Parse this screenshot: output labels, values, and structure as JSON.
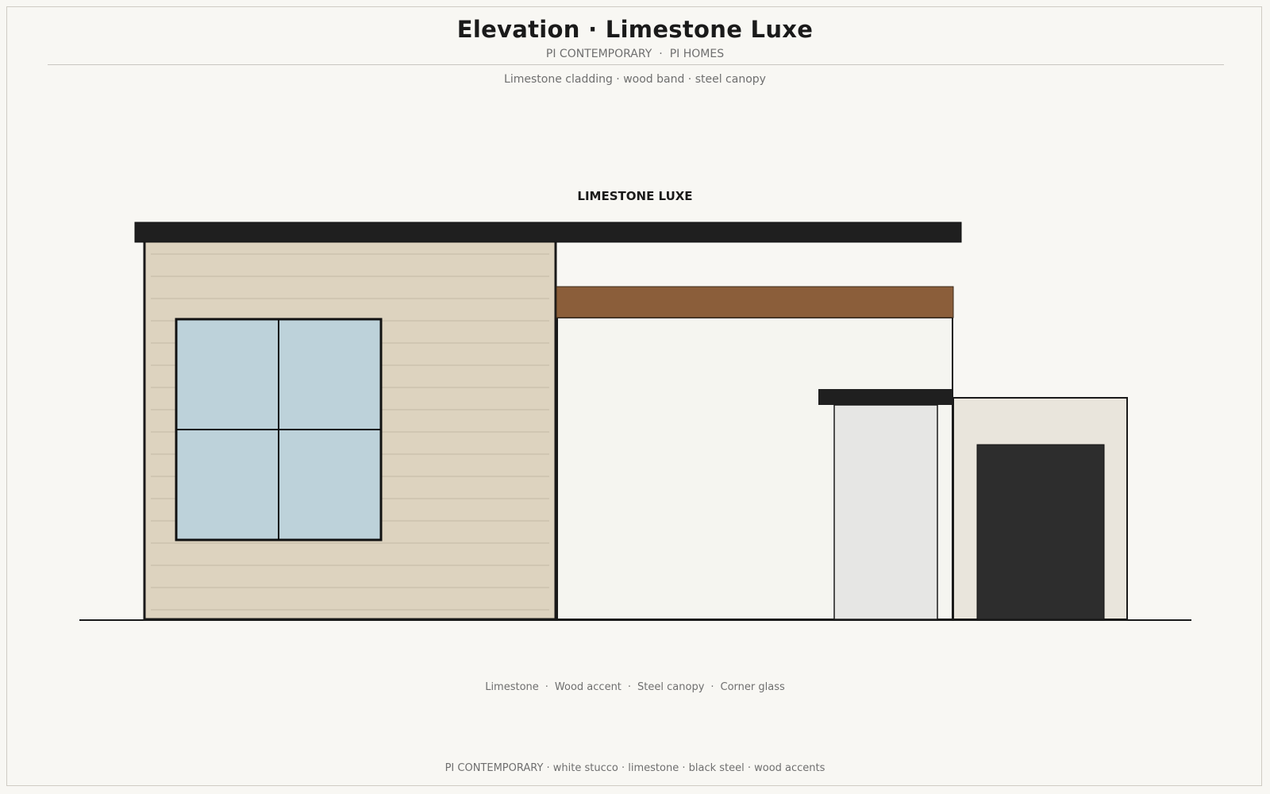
{
  "header": {
    "title": "Elevation · Limestone Luxe",
    "brand": "PI CONTEMPORARY",
    "company": "PI HOMES",
    "separator": "·"
  },
  "subtitle": "Limestone cladding · wood band · steel canopy",
  "drawing": {
    "label": "LIMESTONE LUXE"
  },
  "legend": {
    "separator": "·",
    "items": [
      "Limestone",
      "Wood accent",
      "Steel canopy",
      "Corner glass"
    ]
  },
  "footer": "PI CONTEMPORARY · white stucco · limestone · black steel · wood accents",
  "colors": {
    "background": "#f8f7f3",
    "limestone": "#ddd3bf",
    "wood": "#8b5e3a",
    "steel": "#1f1f1f",
    "glass": "#bdd2da",
    "stucco": "#f5f5f0",
    "garage_door": "#2d2d2d",
    "entry_wall": "#e9e5dc",
    "door_panel": "#e6e6e4"
  }
}
